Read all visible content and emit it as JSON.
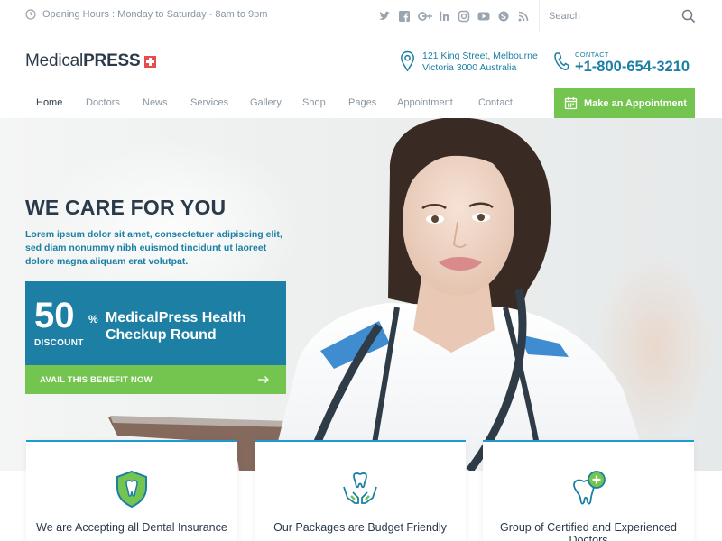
{
  "topbar": {
    "hours": "Opening Hours : Monday to Saturday - 8am to 9pm",
    "socials": [
      "twitter-icon",
      "facebook-icon",
      "google-plus-icon",
      "linkedin-icon",
      "instagram-icon",
      "youtube-icon",
      "skype-icon",
      "rss-icon"
    ],
    "search_placeholder": "Search"
  },
  "header": {
    "logo_light": "Medical",
    "logo_bold": "PRESS",
    "address_line1": "121 King Street, Melbourne",
    "address_line2": "Victoria 3000 Australia",
    "contact_label": "CONTACT",
    "phone": "+1-800-654-3210"
  },
  "nav": {
    "items": [
      "Home",
      "Doctors",
      "News",
      "Services",
      "Gallery",
      "Shop",
      "Pages",
      "Appointment",
      "Contact"
    ],
    "cta": "Make an Appointment"
  },
  "hero": {
    "title": "WE CARE FOR YOU",
    "text": "Lorem ipsum dolor sit amet, consectetuer adipiscing elit, sed diam nonummy nibh euismod tincidunt ut laoreet dolore magna aliquam erat volutpat.",
    "promo_number": "50",
    "promo_percent": "%",
    "promo_discount": "DISCOUNT",
    "promo_title": "MedicalPress Health Checkup Round",
    "avail": "AVAIL THIS BENEFIT NOW"
  },
  "features": [
    {
      "title": "We are Accepting all Dental Insurance"
    },
    {
      "title": "Our Packages are Budget Friendly"
    },
    {
      "title": "Group of Certified and Experienced Doctors"
    }
  ],
  "colors": {
    "primary_blue": "#1d7fa3",
    "accent_green": "#74c54f",
    "dark_text": "#2b3a4a",
    "muted_text": "#8a96a3",
    "logo_red": "#e84c4c"
  }
}
